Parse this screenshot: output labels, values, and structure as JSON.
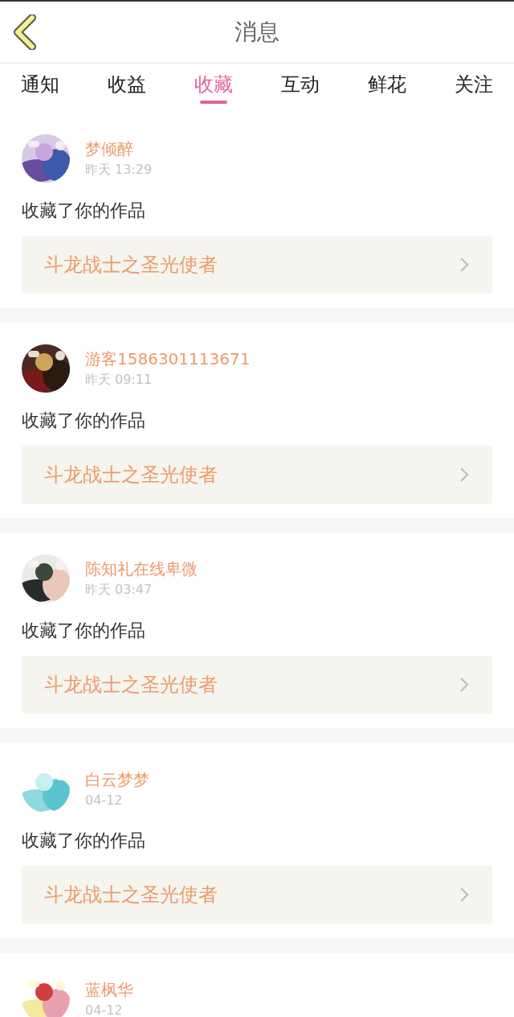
{
  "header": {
    "title": "消息"
  },
  "tabs": [
    {
      "label": "通知",
      "selected": false
    },
    {
      "label": "收益",
      "selected": false
    },
    {
      "label": "收藏",
      "selected": true
    },
    {
      "label": "互动",
      "selected": false
    },
    {
      "label": "鲜花",
      "selected": false
    },
    {
      "label": "关注",
      "selected": false
    }
  ],
  "messages": [
    {
      "name": "梦倾醉",
      "time": "昨天 13:29",
      "action": "收藏了你的作品",
      "work": "斗龙战士之圣光使者"
    },
    {
      "name": "游客1586301113671",
      "time": "昨天 09:11",
      "action": "收藏了你的作品",
      "work": "斗龙战士之圣光使者"
    },
    {
      "name": "陈知礼在线卑微",
      "time": "昨天 03:47",
      "action": "收藏了你的作品",
      "work": "斗龙战士之圣光使者"
    },
    {
      "name": "白云梦梦",
      "time": "04-12",
      "action": "收藏了你的作品",
      "work": "斗龙战士之圣光使者"
    },
    {
      "name": "蓝枫华",
      "time": "04-12"
    }
  ]
}
